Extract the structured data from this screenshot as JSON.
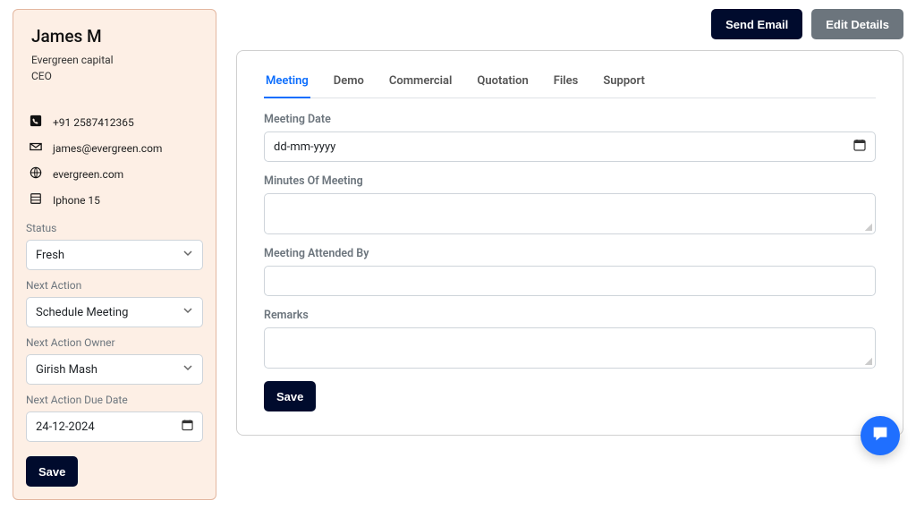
{
  "actions": {
    "send_email": "Send Email",
    "edit_details": "Edit Details"
  },
  "contact": {
    "name": "James M",
    "company": "Evergreen capital",
    "role": "CEO",
    "phone": "+91 2587412365",
    "email": "james@evergreen.com",
    "website": "evergreen.com",
    "device": "Iphone 15"
  },
  "side_form": {
    "status_label": "Status",
    "status_value": "Fresh",
    "next_action_label": "Next Action",
    "next_action_value": "Schedule Meeting",
    "owner_label": "Next Action Owner",
    "owner_value": "Girish Mash",
    "due_label": "Next Action Due Date",
    "due_value": "24-12-2024",
    "save": "Save"
  },
  "tabs": {
    "meeting": "Meeting",
    "demo": "Demo",
    "commercial": "Commercial",
    "quotation": "Quotation",
    "files": "Files",
    "support": "Support"
  },
  "meeting_form": {
    "date_label": "Meeting Date",
    "date_placeholder": "dd-mm-yyyy",
    "minutes_label": "Minutes Of Meeting",
    "attended_label": "Meeting Attended By",
    "remarks_label": "Remarks",
    "save": "Save"
  }
}
